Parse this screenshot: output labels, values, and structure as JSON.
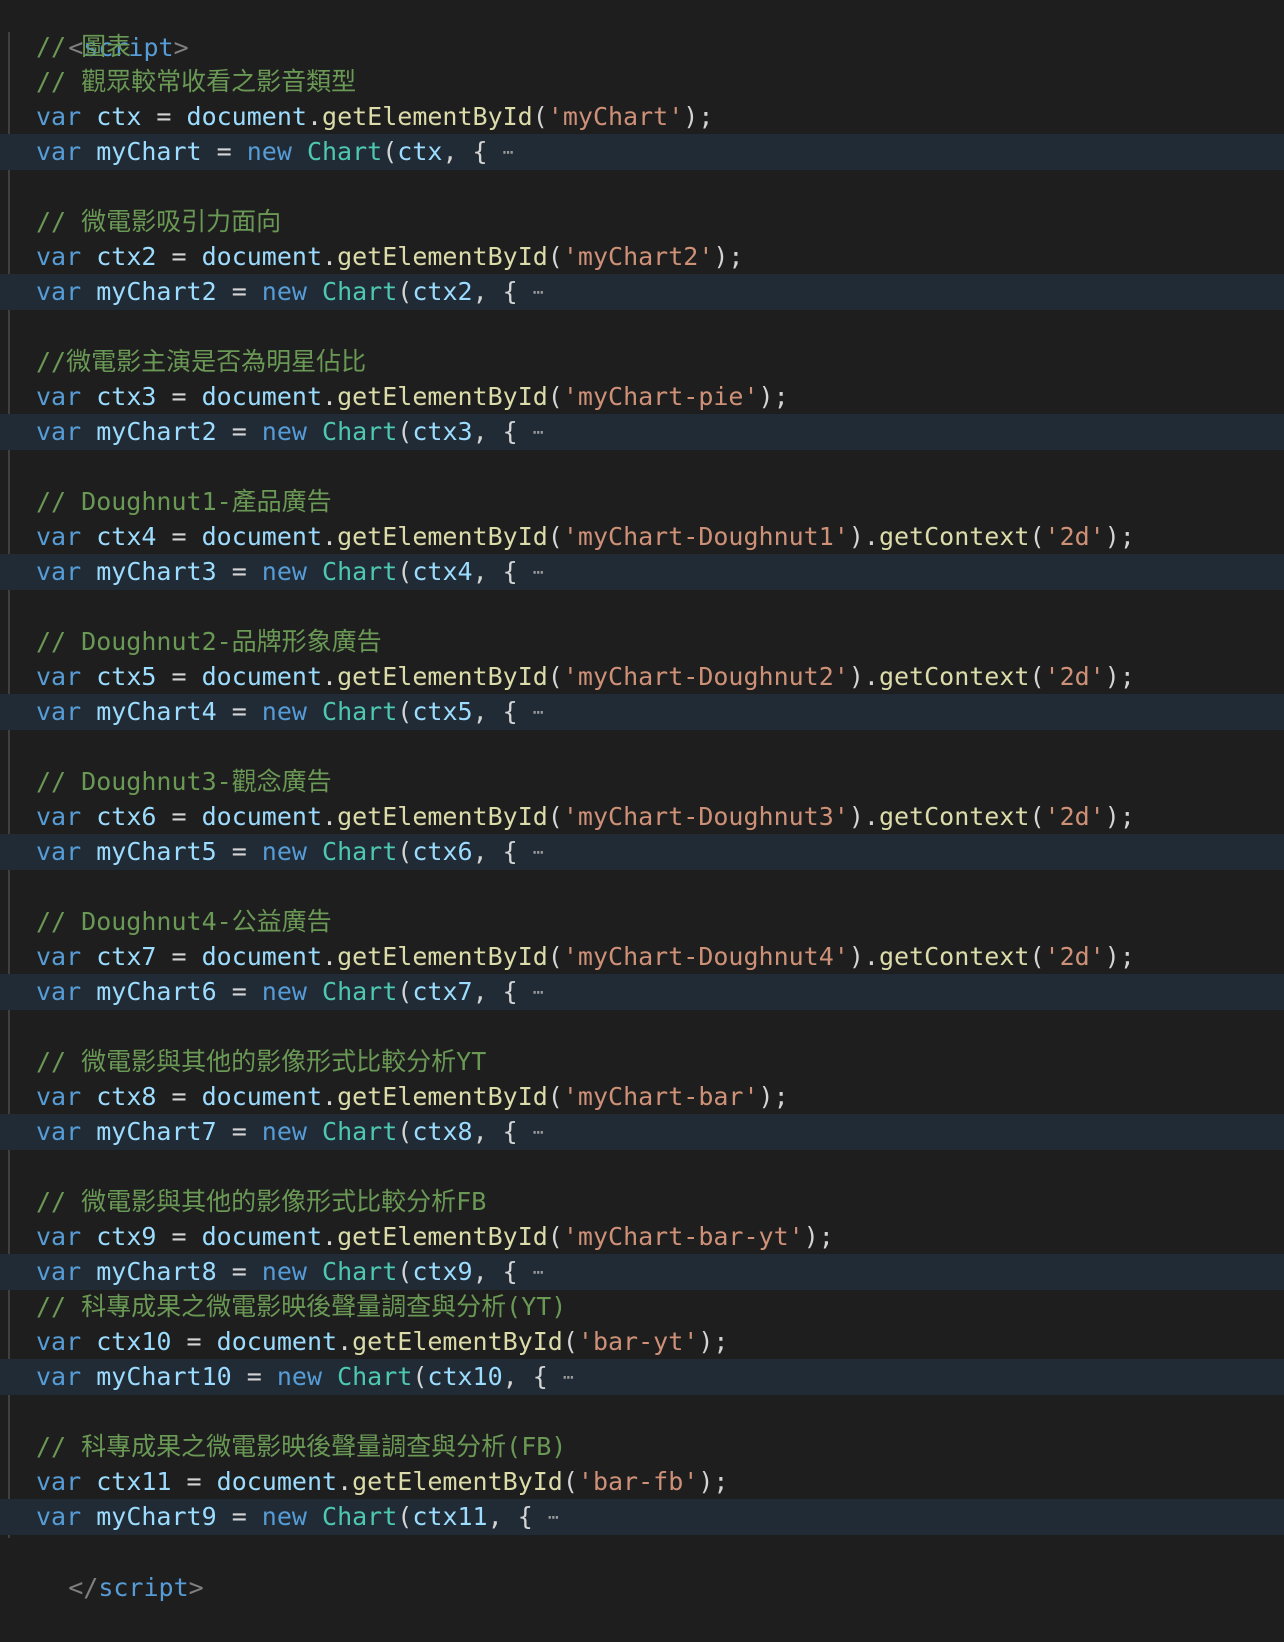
{
  "script_tag": {
    "open_bracket": "<",
    "name": "script",
    "close_bracket": ">",
    "end_open": "</"
  },
  "keywords": {
    "var": "var",
    "new": "new",
    "document": "document",
    "getById": "getElementById",
    "getContext": "getContext",
    "Chart": "Chart",
    "ellipsis": "⋯"
  },
  "comments": {
    "c1": "// 圖表",
    "c2": "// 觀眾較常收看之影音類型",
    "c3": "// 微電影吸引力面向",
    "c4": "//微電影主演是否為明星佔比",
    "c5": "// Doughnut1-產品廣告",
    "c6": "// Doughnut2-品牌形象廣告",
    "c7": "// Doughnut3-觀念廣告",
    "c8": "// Doughnut4-公益廣告",
    "c9": "// 微電影與其他的影像形式比較分析YT",
    "c10": "// 微電影與其他的影像形式比較分析FB",
    "c11": "// 科專成果之微電影映後聲量調查與分析(YT)",
    "c12": "// 科專成果之微電影映後聲量調查與分析(FB)"
  },
  "ctx": {
    "v1": "ctx",
    "s1": "'myChart'",
    "v2": "ctx2",
    "s2": "'myChart2'",
    "v3": "ctx3",
    "s3": "'myChart-pie'",
    "v4": "ctx4",
    "s4": "'myChart-Doughnut1'",
    "v5": "ctx5",
    "s5": "'myChart-Doughnut2'",
    "v6": "ctx6",
    "s6": "'myChart-Doughnut3'",
    "v7": "ctx7",
    "s7": "'myChart-Doughnut4'",
    "v8": "ctx8",
    "s8": "'myChart-bar'",
    "v9": "ctx9",
    "s9": "'myChart-bar-yt'",
    "v10": "ctx10",
    "s10": "'bar-yt'",
    "v11": "ctx11",
    "s11": "'bar-fb'",
    "str2d": "'2d'"
  },
  "charts": {
    "n1": "myChart",
    "a1": "ctx",
    "n2": "myChart2",
    "a2": "ctx2",
    "n3": "myChart2",
    "a3": "ctx3",
    "n4": "myChart3",
    "a4": "ctx4",
    "n5": "myChart4",
    "a5": "ctx5",
    "n6": "myChart5",
    "a6": "ctx6",
    "n7": "myChart6",
    "a7": "ctx7",
    "n8": "myChart7",
    "a8": "ctx8",
    "n9": "myChart8",
    "a9": "ctx9",
    "n10": "myChart10",
    "a10": "ctx10",
    "n11": "myChart9",
    "a11": "ctx11"
  },
  "colors": {
    "background": "#1e1e1e",
    "keyword": "#569cd6",
    "variable": "#9cdcfe",
    "function": "#dcdcaa",
    "class": "#4ec9b0",
    "string": "#ce9178",
    "comment": "#6a9955",
    "highlight": "#212b36"
  }
}
